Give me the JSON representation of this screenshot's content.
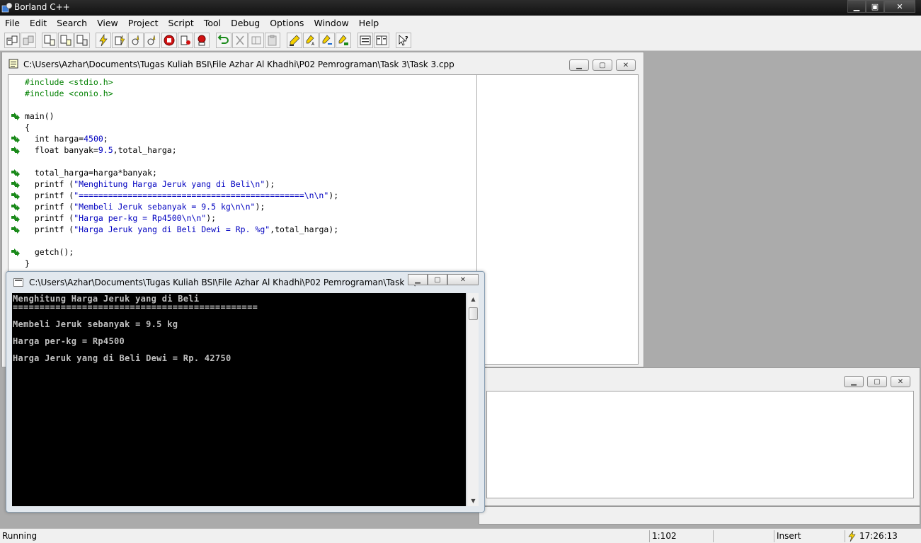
{
  "app": {
    "title": "Borland C++"
  },
  "menu": [
    "File",
    "Edit",
    "Search",
    "View",
    "Project",
    "Script",
    "Tool",
    "Debug",
    "Options",
    "Window",
    "Help"
  ],
  "editor": {
    "path": "C:\\Users\\Azhar\\Documents\\Tugas Kuliah BSI\\File Azhar Al Khadhi\\P02 Pemrograman\\Task 3\\Task 3.cpp",
    "lines": [
      {
        "t": [
          {
            "c": "pp",
            "s": "#include <stdio.h>"
          }
        ]
      },
      {
        "t": [
          {
            "c": "pp",
            "s": "#include <conio.h>"
          }
        ]
      },
      {
        "t": []
      },
      {
        "t": [
          {
            "c": "",
            "s": "main()"
          }
        ],
        "mark": true
      },
      {
        "t": [
          {
            "c": "",
            "s": "{"
          }
        ]
      },
      {
        "t": [
          {
            "c": "",
            "s": "  int harga="
          },
          {
            "c": "nm",
            "s": "4500"
          },
          {
            "c": "",
            "s": ";"
          }
        ],
        "mark": true
      },
      {
        "t": [
          {
            "c": "",
            "s": "  float banyak="
          },
          {
            "c": "nm",
            "s": "9.5"
          },
          {
            "c": "",
            "s": ",total_harga;"
          }
        ],
        "mark": true
      },
      {
        "t": []
      },
      {
        "t": [
          {
            "c": "",
            "s": "  total_harga=harga*banyak;"
          }
        ],
        "mark": true
      },
      {
        "t": [
          {
            "c": "",
            "s": "  printf ("
          },
          {
            "c": "st",
            "s": "\"Menghitung Harga Jeruk yang di Beli\\n\""
          },
          {
            "c": "",
            "s": ");"
          }
        ],
        "mark": true
      },
      {
        "t": [
          {
            "c": "",
            "s": "  printf ("
          },
          {
            "c": "st",
            "s": "\"==============================================\\n\\n\""
          },
          {
            "c": "",
            "s": ");"
          }
        ],
        "mark": true
      },
      {
        "t": [
          {
            "c": "",
            "s": "  printf ("
          },
          {
            "c": "st",
            "s": "\"Membeli Jeruk sebanyak = 9.5 kg\\n\\n\""
          },
          {
            "c": "",
            "s": ");"
          }
        ],
        "mark": true
      },
      {
        "t": [
          {
            "c": "",
            "s": "  printf ("
          },
          {
            "c": "st",
            "s": "\"Harga per-kg = Rp4500\\n\\n\""
          },
          {
            "c": "",
            "s": ");"
          }
        ],
        "mark": true
      },
      {
        "t": [
          {
            "c": "",
            "s": "  printf ("
          },
          {
            "c": "st",
            "s": "\"Harga Jeruk yang di Beli Dewi = Rp. %g\""
          },
          {
            "c": "",
            "s": ",total_harga);"
          }
        ],
        "mark": true
      },
      {
        "t": []
      },
      {
        "t": [
          {
            "c": "",
            "s": "  getch();"
          }
        ],
        "mark": true
      },
      {
        "t": [
          {
            "c": "",
            "s": "}"
          }
        ]
      }
    ]
  },
  "console": {
    "title": "C:\\Users\\Azhar\\Documents\\Tugas Kuliah BSI\\File Azhar Al Khadhi\\P02 Pemrograman\\Task 3\\Task ...",
    "lines": [
      "Menghitung Harga Jeruk yang di Beli",
      "==============================================",
      "",
      "Membeli Jeruk sebanyak = 9.5 kg",
      "",
      "Harga per-kg = Rp4500",
      "",
      "Harga Jeruk yang di Beli Dewi = Rp. 42750"
    ]
  },
  "status": {
    "state": "Running",
    "position": "1:102",
    "mode": "Insert",
    "time": "17:26:13"
  },
  "colors": {
    "preprocessor": "#008000",
    "literal": "#0000c0",
    "console_bg": "#000000",
    "console_fg": "#c0c0c0"
  }
}
